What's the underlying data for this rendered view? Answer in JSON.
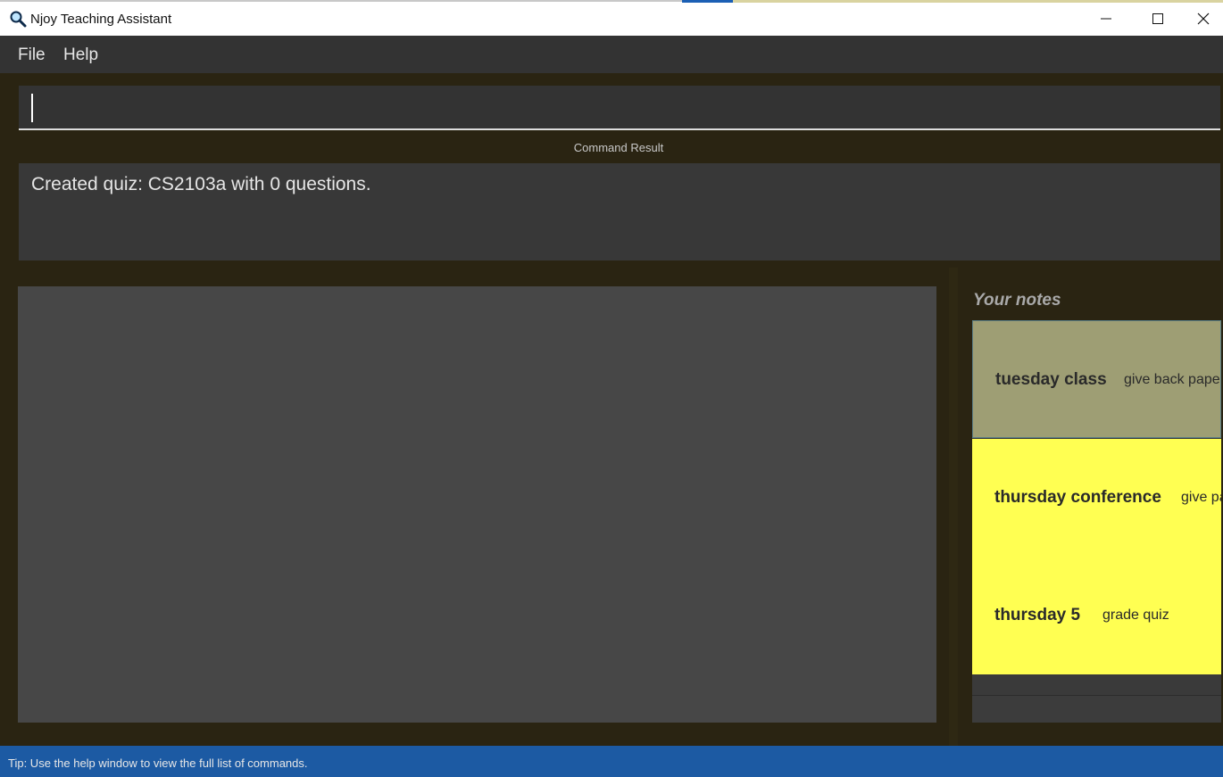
{
  "window": {
    "title": "Njoy Teaching Assistant",
    "icon": "magnifier-app-icon",
    "controls": [
      "minimize-icon",
      "maximize-icon",
      "close-icon"
    ]
  },
  "menu": {
    "file": "File",
    "help": "Help"
  },
  "command": {
    "value": ""
  },
  "result": {
    "label": "Command Result",
    "text": "Created quiz: CS2103a with 0 questions."
  },
  "notes": {
    "heading": "Your notes",
    "items": [
      {
        "title": "tuesday class",
        "body": "give back papers"
      },
      {
        "title": "thursday conference",
        "body": "give papers"
      },
      {
        "title": "thursday 5",
        "body": "grade quiz"
      }
    ]
  },
  "status": {
    "tip": "Tip: Use the help window to view the full list of commands."
  },
  "colors": {
    "background": "#2a2412",
    "panel": "#474747",
    "note_selected": "#9e9e74",
    "note": "#ffff52",
    "statusbar": "#1c5aa3"
  }
}
